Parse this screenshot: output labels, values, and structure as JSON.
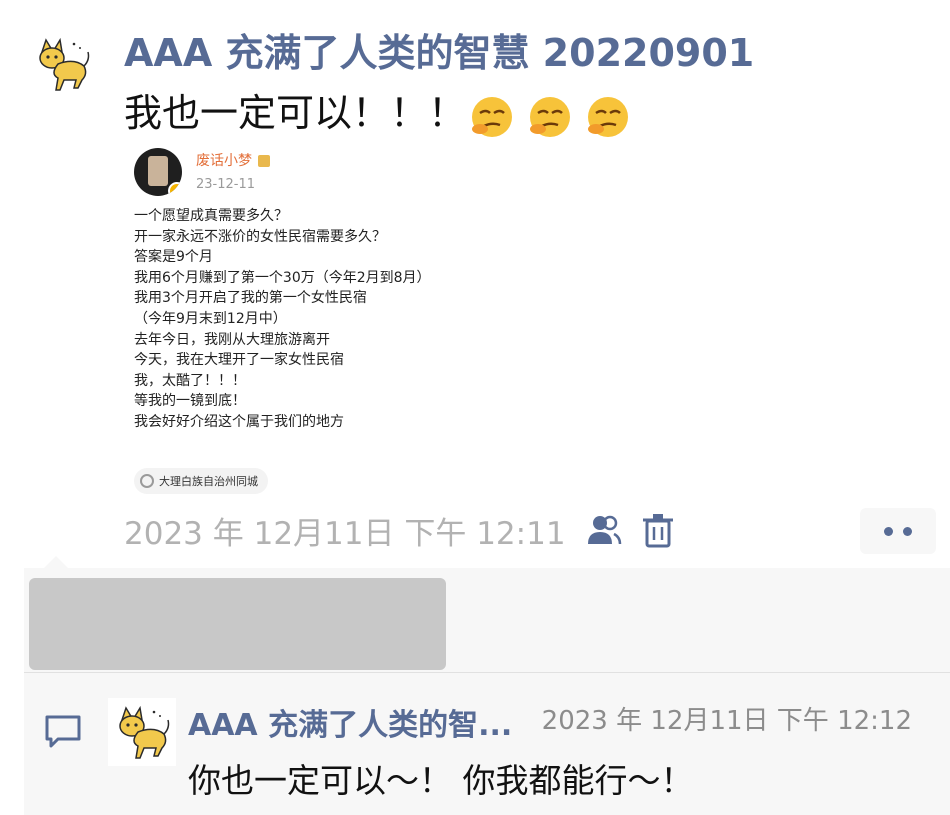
{
  "post": {
    "nickname": "AAA 充满了人类的智慧 20220901",
    "text": "我也一定可以！！！",
    "emoji_count": 3,
    "timestamp": "2023 年 12月11日 下午 12:11"
  },
  "embedded": {
    "author": "废话小梦",
    "date": "23-12-11",
    "lines": [
      "一个愿望成真需要多久？",
      "开一家永远不涨价的女性民宿需要多久？",
      "答案是9个月",
      "我用6个月赚到了第一个30万（今年2月到8月）",
      "我用3个月开启了我的第一个女性民宿",
      "（今年9月末到12月中）",
      "去年今日，我刚从大理旅游离开",
      "今天，我在大理开了一家女性民宿",
      "我，太酷了！！！",
      "等我的一镜到底！",
      "我会好好介绍这个属于我们的地方"
    ],
    "location": "大理白族自治州同城"
  },
  "comment": {
    "author": "AAA 充满了人类的智...",
    "time": "2023 年 12月11日 下午 12:12",
    "text": "你也一定可以～！ 你我都能行～！"
  },
  "colors": {
    "name_blue": "#576b95",
    "timestamp_gray": "#b2b2b2",
    "comment_bg": "#f7f7f7"
  },
  "icons": {
    "friends": "friends-visibility-icon",
    "trash": "trash-icon",
    "more": "more-dots-icon",
    "comment": "comment-bubble-icon"
  }
}
